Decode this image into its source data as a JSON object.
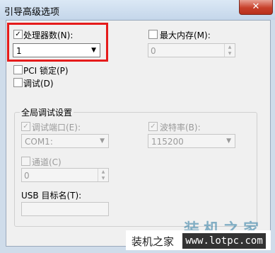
{
  "window": {
    "title": "引导高级选项",
    "close_glyph": "✕"
  },
  "processors": {
    "label": "处理器数(N):",
    "checked": true,
    "value": "1"
  },
  "max_memory": {
    "label": "最大内存(M):",
    "checked": false,
    "value": "0"
  },
  "pci_lock": {
    "label": "PCI 锁定(P)",
    "checked": false
  },
  "debug": {
    "label": "调试(D)",
    "checked": false
  },
  "global_debug": {
    "title": "全局调试设置",
    "debug_port": {
      "label": "调试端口(E):",
      "checked": true,
      "value": "COM1:"
    },
    "baud_rate": {
      "label": "波特率(B):",
      "checked": true,
      "value": "115200"
    },
    "channel": {
      "label": "通道(C)",
      "checked": false,
      "value": "0"
    },
    "usb_target": {
      "label": "USB 目标名(T):",
      "value": ""
    }
  },
  "watermark": {
    "big": "装机之家",
    "small": "装机之家",
    "url": "www.lotpc.com"
  },
  "colors": {
    "highlight": "#e51b1b",
    "title_bar": "#c4d6ea"
  }
}
